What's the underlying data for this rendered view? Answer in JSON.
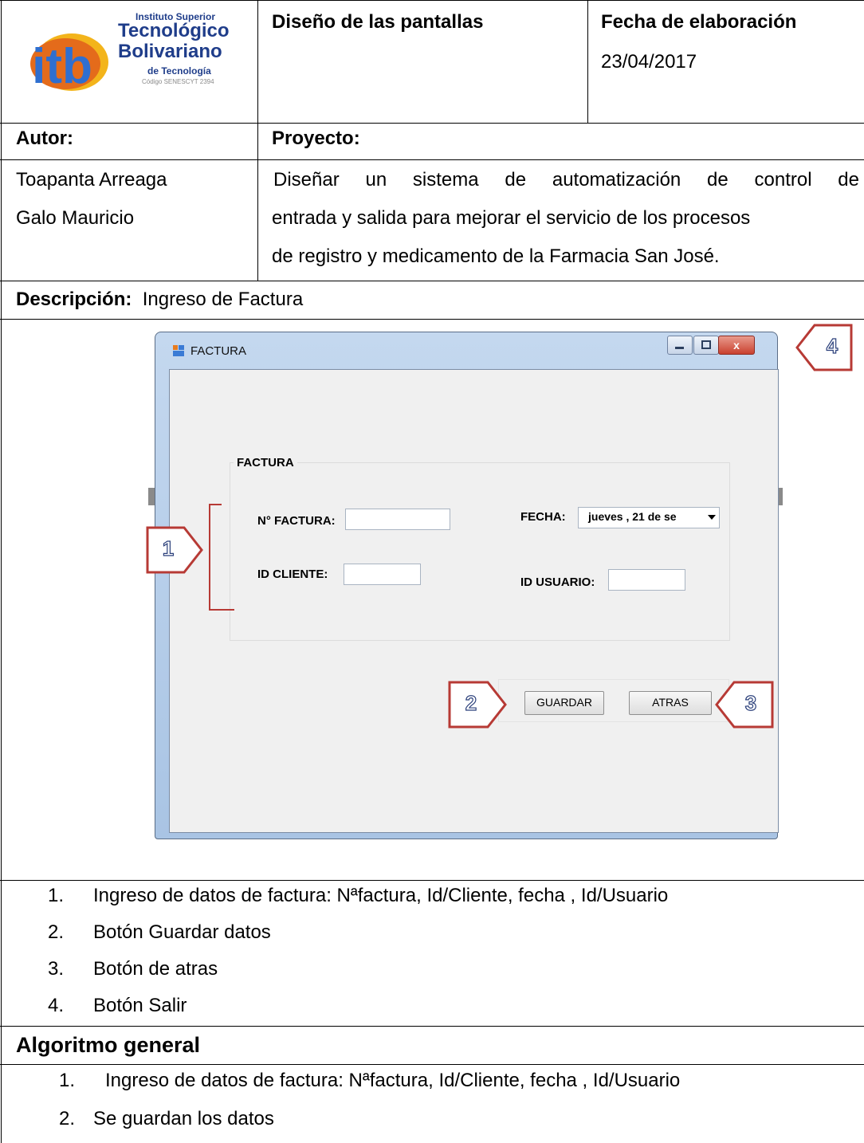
{
  "header": {
    "logo": {
      "line1": "Instituto Superior",
      "line2": "Tecnológico",
      "line3": "Bolivariano",
      "line4": "de Tecnología",
      "line5": "Código SENESCYT 2394",
      "mark": "itb"
    },
    "design_title": "Diseño de las pantallas",
    "date_label": "Fecha de elaboración",
    "date_value": "23/04/2017"
  },
  "info": {
    "author_label": "Autor:",
    "project_label": "Proyecto:",
    "author_line1": "Toapanta Arreaga",
    "author_line2": "Galo Mauricio",
    "project_line1": "Diseñar un sistema de automatización de control de",
    "project_line2": "entrada y salida para mejorar el servicio de los procesos",
    "project_line3": "de registro y medicamento de la Farmacia San José.",
    "description_label": "Descripción:",
    "description_value": "Ingreso de Factura"
  },
  "window": {
    "title": "FACTURA",
    "close_glyph": "x",
    "group_title": "FACTURA",
    "invoice_label": "N° FACTURA:",
    "client_label": "ID CLIENTE:",
    "date_label": "FECHA:",
    "date_value": "jueves  , 21 de se",
    "user_label": "ID USUARIO:",
    "save_button": "GUARDAR",
    "back_button": "ATRAS"
  },
  "callouts": [
    "1",
    "2",
    "3",
    "4"
  ],
  "legend": {
    "items": [
      {
        "num": "1.",
        "text": "Ingreso de datos de factura: Nªfactura, Id/Cliente, fecha , Id/Usuario"
      },
      {
        "num": "2.",
        "text": "Botón Guardar datos"
      },
      {
        "num": "3.",
        "text": "Botón de atras"
      },
      {
        "num": "4.",
        "text": "Botón Salir"
      }
    ]
  },
  "algorithm": {
    "title": "Algoritmo general",
    "items": [
      {
        "num": "1.",
        "text": "Ingreso de datos de factura: Nªfactura, Id/Cliente, fecha , Id/Usuario"
      },
      {
        "num": "2.",
        "text": "Se guardan los datos"
      }
    ]
  },
  "colors": {
    "logo_blue": "#1f3d8a",
    "callout_border": "#b73a35",
    "window_frame": "#b4cbe8"
  }
}
